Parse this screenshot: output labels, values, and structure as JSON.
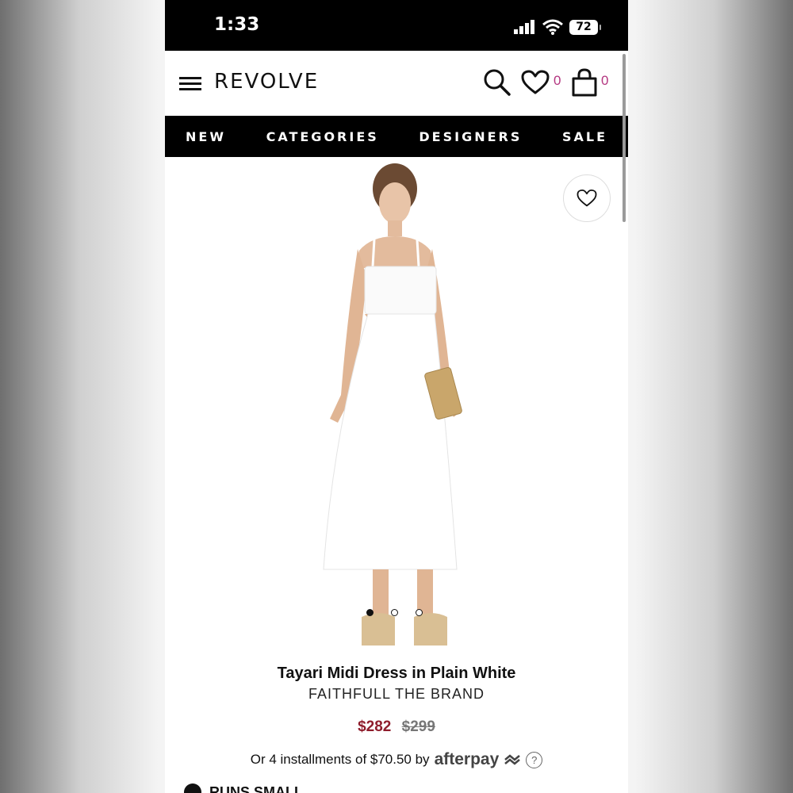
{
  "status_bar": {
    "time": "1:33",
    "battery": "72"
  },
  "header": {
    "logo": "REVOLVE",
    "wishlist_count": "0",
    "bag_count": "0",
    "accent_color": "#b3357f"
  },
  "nav": {
    "items": [
      {
        "label": "NEW"
      },
      {
        "label": "CATEGORIES"
      },
      {
        "label": "DESIGNERS"
      },
      {
        "label": "SALE"
      }
    ]
  },
  "product": {
    "title": "Tayari Midi Dress in Plain White",
    "brand": "FAITHFULL THE BRAND",
    "sale_price": "$282",
    "original_price": "$299",
    "installments_text": "Or 4 installments of $70.50 by",
    "afterpay_label": "afterpay",
    "help_symbol": "?",
    "image_count": 3,
    "active_image": 1,
    "sale_color": "#8f1d2c"
  },
  "fit_note": {
    "label": "RUNS SMALL"
  },
  "icons": [
    "menu-icon",
    "search-icon",
    "heart-icon",
    "bag-icon",
    "wishlist-heart-icon",
    "question-icon"
  ]
}
